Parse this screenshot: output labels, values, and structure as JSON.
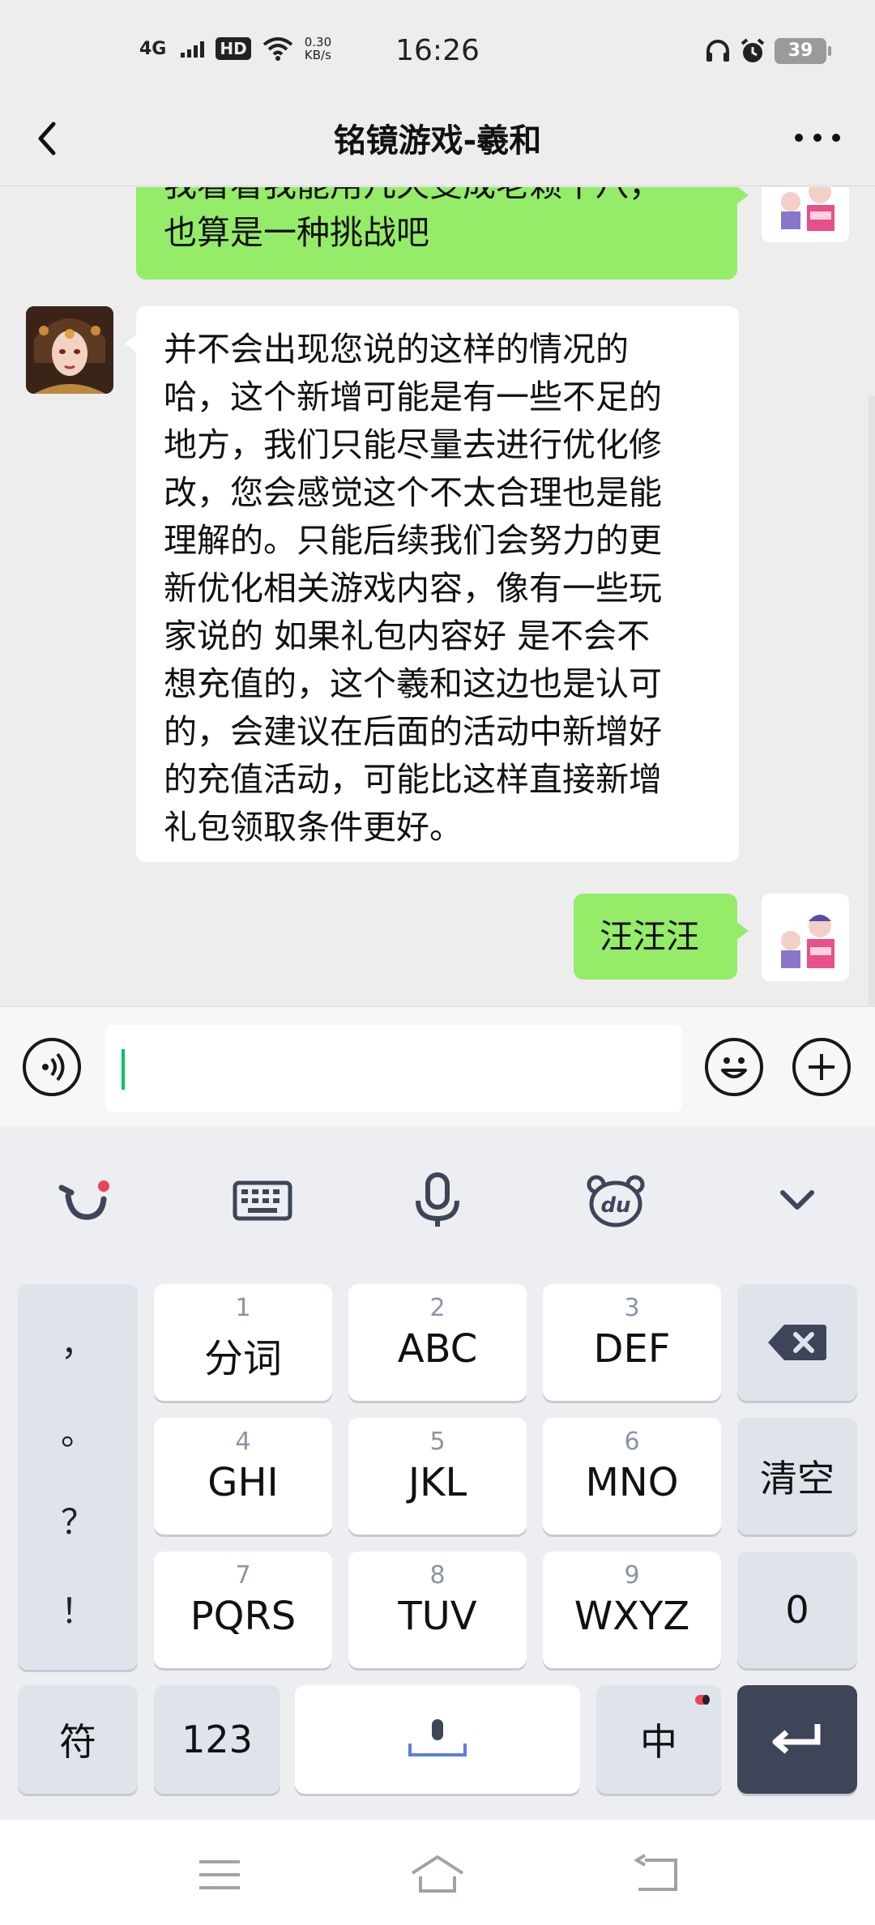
{
  "status_bar": {
    "network": "4G",
    "hd": "HD",
    "speed_value": "0.30",
    "speed_unit": "KB/s",
    "time": "16:26",
    "battery": "39",
    "icons": [
      "signal-icon",
      "wifi-icon",
      "headphones-icon",
      "alarm-icon",
      "battery-icon"
    ]
  },
  "header": {
    "title": "铭镜游戏-羲和",
    "icons": [
      "back-icon",
      "more-icon"
    ]
  },
  "messages": [
    {
      "sender": "me",
      "text_lines": [
        "我看看我能用几天变成老赖十八，",
        "也算是一种挑战吧"
      ]
    },
    {
      "sender": "other",
      "text_lines": [
        "并不会出现您说的这样的情况的",
        "哈，这个新增可能是有一些不足的",
        "地方，我们只能尽量去进行优化修",
        "改，您会感觉这个不太合理也是能",
        "理解的。只能后续我们会努力的更",
        "新优化相关游戏内容，像有一些玩",
        "家说的 如果礼包内容好 是不会不",
        "想充值的，这个羲和这边也是认可",
        "的，会建议在后面的活动中新增好",
        "的充值活动，可能比这样直接新增",
        "礼包领取条件更好。"
      ]
    },
    {
      "sender": "me",
      "text_lines": [
        "汪汪汪"
      ]
    }
  ],
  "input_bar": {
    "value": "",
    "icons": [
      "voice-icon",
      "emoji-icon",
      "plus-icon"
    ]
  },
  "keyboard": {
    "toolbar_icons": [
      "smile-logo-icon",
      "keyboard-icon",
      "microphone-icon",
      "du-bear-icon",
      "collapse-chevron-icon"
    ],
    "punctuation": [
      "，",
      "。",
      "？",
      "！"
    ],
    "keys": [
      {
        "num": "1",
        "label": "分词"
      },
      {
        "num": "2",
        "label": "ABC"
      },
      {
        "num": "3",
        "label": "DEF"
      },
      {
        "num": "4",
        "label": "GHI"
      },
      {
        "num": "5",
        "label": "JKL"
      },
      {
        "num": "6",
        "label": "MNO"
      },
      {
        "num": "7",
        "label": "PQRS"
      },
      {
        "num": "8",
        "label": "TUV"
      },
      {
        "num": "9",
        "label": "WXYZ"
      }
    ],
    "clear": "清空",
    "zero": "0",
    "symbol": "符",
    "numeric": "123",
    "chinese": "中"
  },
  "system_nav": {
    "icons": [
      "menu-icon",
      "home-icon",
      "back-nav-icon"
    ]
  },
  "colors": {
    "my_bubble": "#95ec69",
    "other_bubble": "#ffffff",
    "caret": "#07c160",
    "enter_key": "#3e4558"
  }
}
